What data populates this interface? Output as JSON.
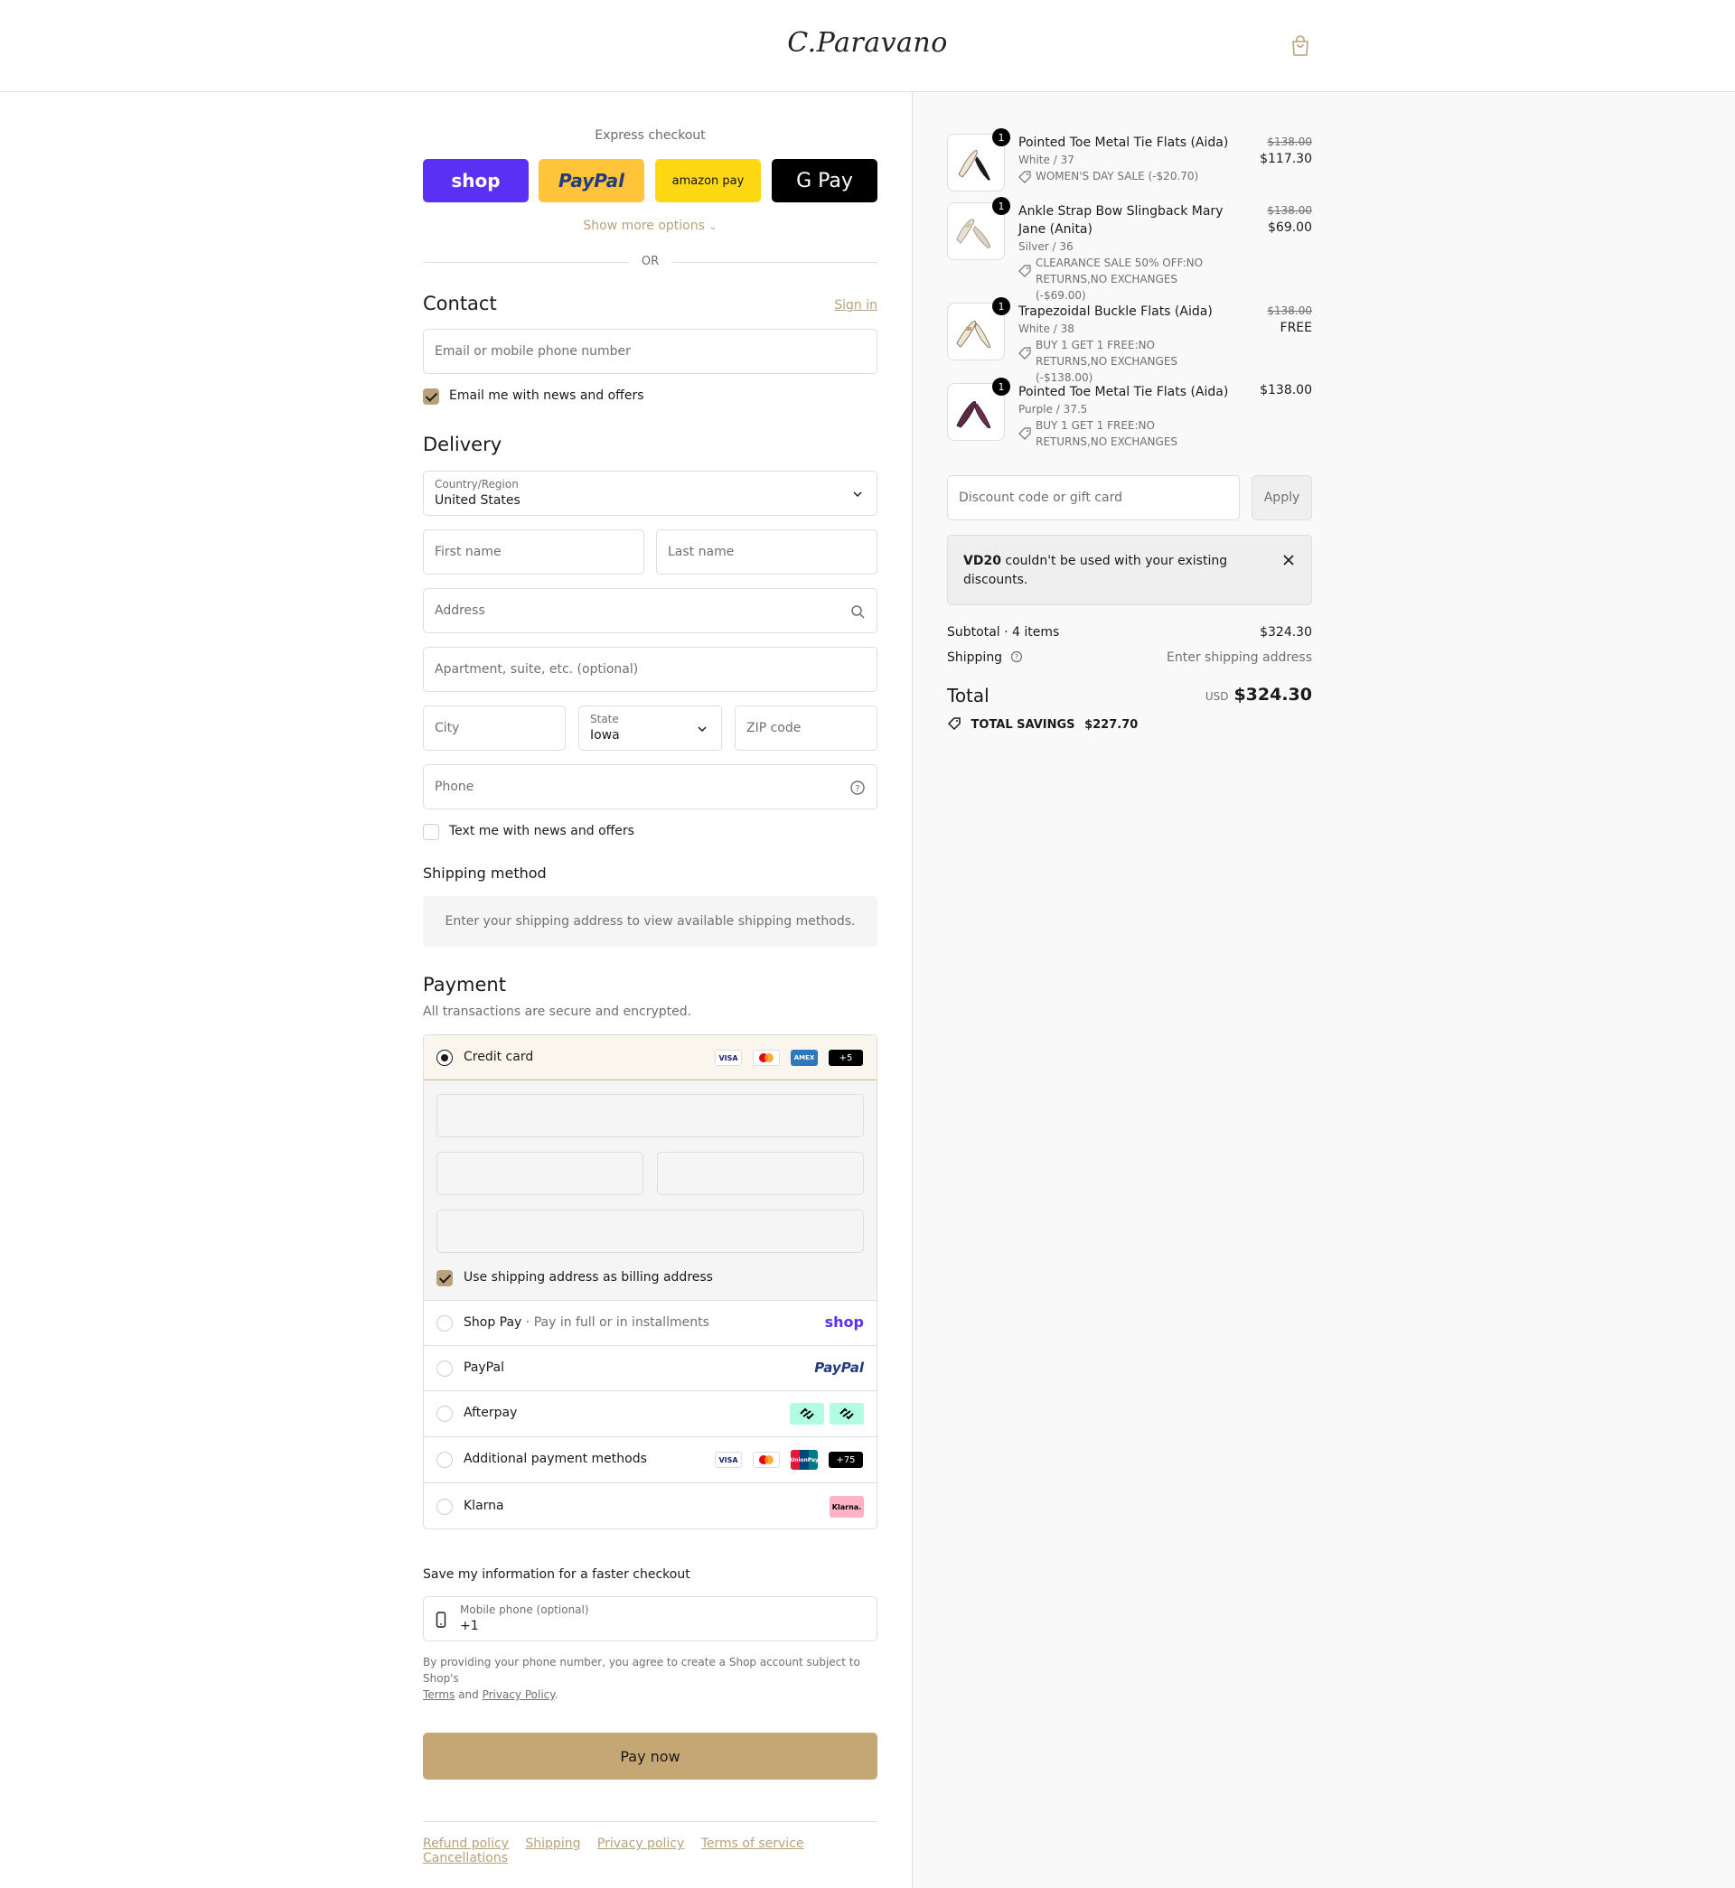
{
  "header": {
    "logo": "C.Paravano",
    "cart_icon": "shopping-bag-icon"
  },
  "express": {
    "title": "Express checkout",
    "buttons": [
      "shop",
      "PayPal",
      "amazon pay",
      "G Pay"
    ],
    "show_more": "Show more options",
    "or": "OR"
  },
  "contact": {
    "title": "Contact",
    "sign_in": "Sign in",
    "email_placeholder": "Email or mobile phone number",
    "news_checkbox": "Email me with news and offers",
    "news_checked": true
  },
  "delivery": {
    "title": "Delivery",
    "country_label": "Country/Region",
    "country_value": "United States",
    "first_name": "First name",
    "last_name": "Last name",
    "address": "Address",
    "apartment": "Apartment, suite, etc. (optional)",
    "city": "City",
    "state_label": "State",
    "state_value": "Iowa",
    "zip": "ZIP code",
    "phone": "Phone",
    "text_checkbox": "Text me with news and offers",
    "text_checked": false
  },
  "shipping_method": {
    "title": "Shipping method",
    "notice": "Enter your shipping address to view available shipping methods."
  },
  "payment": {
    "title": "Payment",
    "subtitle": "All transactions are secure and encrypted.",
    "methods": [
      {
        "label": "Credit card",
        "selected": true,
        "badges": [
          "VISA",
          "MC",
          "AMEX",
          "+5"
        ]
      },
      {
        "label": "Shop Pay",
        "extra": "Pay in full or in installments",
        "logo": "shop"
      },
      {
        "label": "PayPal",
        "logo": "PayPal"
      },
      {
        "label": "Afterpay"
      },
      {
        "label": "Additional payment methods",
        "badges": [
          "VISA",
          "MC",
          "UnionPay",
          "+75"
        ]
      },
      {
        "label": "Klarna",
        "logo": "Klarna."
      }
    ],
    "billing_checkbox": "Use shipping address as billing address",
    "billing_checked": true
  },
  "save_info": {
    "title": "Save my information for a faster checkout",
    "phone_label": "Mobile phone (optional)",
    "phone_value": "+1",
    "legal_1": "By providing your phone number, you agree to create a Shop account subject to Shop's",
    "legal_terms": "Terms",
    "legal_and": "and",
    "legal_privacy": "Privacy Policy",
    "legal_end": "."
  },
  "pay_now": "Pay now",
  "footer": [
    "Refund policy",
    "Shipping",
    "Privacy policy",
    "Terms of service",
    "Cancellations"
  ],
  "order": {
    "items": [
      {
        "qty": "1",
        "name": "Pointed Toe Metal Tie Flats (Aida)",
        "variant": "White / 37",
        "discount": "WOMEN'S DAY SALE (-$20.70)",
        "old_price": "$138.00",
        "price": "$117.30"
      },
      {
        "qty": "1",
        "name": "Ankle Strap Bow Slingback Mary Jane (Anita)",
        "variant": "Silver / 36",
        "discount": "CLEARANCE SALE 50% OFF:NO RETURNS,NO EXCHANGES (-$69.00)",
        "old_price": "$138.00",
        "price": "$69.00"
      },
      {
        "qty": "1",
        "name": "Trapezoidal Buckle Flats (Aida)",
        "variant": "White / 38",
        "discount": "BUY 1 GET 1 FREE:NO RETURNS,NO EXCHANGES (-$138.00)",
        "old_price": "$138.00",
        "price": "FREE"
      },
      {
        "qty": "1",
        "name": "Pointed Toe Metal Tie Flats (Aida)",
        "variant": "Purple / 37.5",
        "discount": "BUY 1 GET 1 FREE:NO RETURNS,NO EXCHANGES",
        "old_price": "",
        "price": "$138.00"
      }
    ],
    "discount_placeholder": "Discount code or gift card",
    "apply": "Apply",
    "error_code": "VD20",
    "error_text": "couldn't be used with your existing discounts.",
    "subtotal_label": "Subtotal · 4 items",
    "subtotal": "$324.30",
    "shipping_label": "Shipping",
    "shipping_value": "Enter shipping address",
    "total_label": "Total",
    "currency": "USD",
    "total": "$324.30",
    "savings_label": "TOTAL SAVINGS",
    "savings": "$227.70"
  },
  "colors": {
    "accent": "#c4a774",
    "link": "#b9a27a",
    "shop": "#5a31f4",
    "paypal": "#ffc439",
    "amazon": "#ffd814"
  }
}
